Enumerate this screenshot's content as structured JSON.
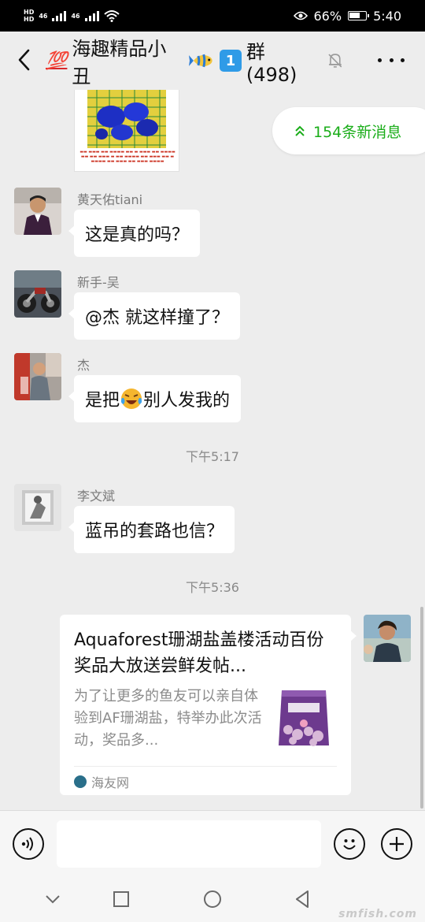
{
  "status_bar": {
    "carrier_1": "HD",
    "carrier_2": "HD",
    "net_1": "46",
    "net_2": "46",
    "battery_percent": "66%",
    "battery_level": 0.66,
    "time": "5:40"
  },
  "header": {
    "title_prefix": "💯",
    "title_name": "海趣精品小丑",
    "title_number": "1",
    "title_suffix": "群(498)"
  },
  "new_messages": {
    "label": "154条新消息"
  },
  "messages": [
    {
      "sender": "黄天佑tiani",
      "text": "这是真的吗？"
    },
    {
      "sender": "新手-吴",
      "text": "@杰  就这样撞了？"
    },
    {
      "sender": "杰",
      "text_before": "是把",
      "text_after": "别人发我的"
    },
    {
      "sender": "李文斌",
      "text": "蓝吊的套路也信？"
    }
  ],
  "timestamps": [
    "下午5:17",
    "下午5:36"
  ],
  "shared_card": {
    "title": "Aquaforest珊湖盐盖楼活动百份奖品大放送尝鲜发帖...",
    "description": "为了让更多的鱼友可以亲自体验到AF珊湖盐，特举办此次活动，奖品多...",
    "source": "海友网"
  },
  "input": {
    "placeholder": ""
  },
  "watermark": "smfish.com",
  "colors": {
    "accent_green": "#1aad19",
    "background": "#ededed"
  },
  "icons": [
    "back-icon",
    "mute-bell-icon",
    "more-icon",
    "double-chevron-up-icon",
    "voice-icon",
    "emoji-icon",
    "plus-icon"
  ]
}
